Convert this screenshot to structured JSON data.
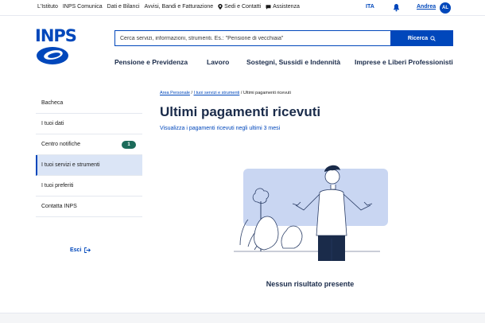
{
  "topbar": {
    "links": [
      "L'Istituto",
      "INPS Comunica",
      "Dati e Bilanci",
      "Avvisi, Bandi e Fatturazione",
      "Sedi e Contatti",
      "Assistenza"
    ],
    "language": "ITA",
    "user_name": "Andrea",
    "user_initials": "AL"
  },
  "header": {
    "logo_text": "INPS",
    "search_placeholder": "Cerca servizi, informazioni, strumenti. Es.: \"Pensione di vecchiaia\"",
    "search_button": "Ricerca",
    "nav": [
      "Pensione e Previdenza",
      "Lavoro",
      "Sostegni, Sussidi e Indennità",
      "Imprese e Liberi Professionisti"
    ]
  },
  "sidebar": {
    "items": [
      {
        "label": "Bacheca"
      },
      {
        "label": "I tuoi dati"
      },
      {
        "label": "Centro notifiche",
        "badge": "1"
      },
      {
        "label": "I tuoi servizi e strumenti"
      },
      {
        "label": "I tuoi preferiti"
      },
      {
        "label": "Contatta INPS"
      }
    ],
    "logout": "Esci"
  },
  "main": {
    "breadcrumb": [
      "Area Personale",
      "I tuoi servizi e strumenti",
      "Ultimi pagamenti ricevuti"
    ],
    "title": "Ultimi pagamenti ricevuti",
    "subtitle": "Visualizza i pagamenti ricevuti negli ultimi 3 mesi",
    "empty_message": "Nessun risultato presente"
  },
  "colors": {
    "primary": "#0047bb",
    "heading": "#1a2b4a",
    "badge": "#1c6b5a",
    "illustration_bg": "#c9d6f2"
  }
}
